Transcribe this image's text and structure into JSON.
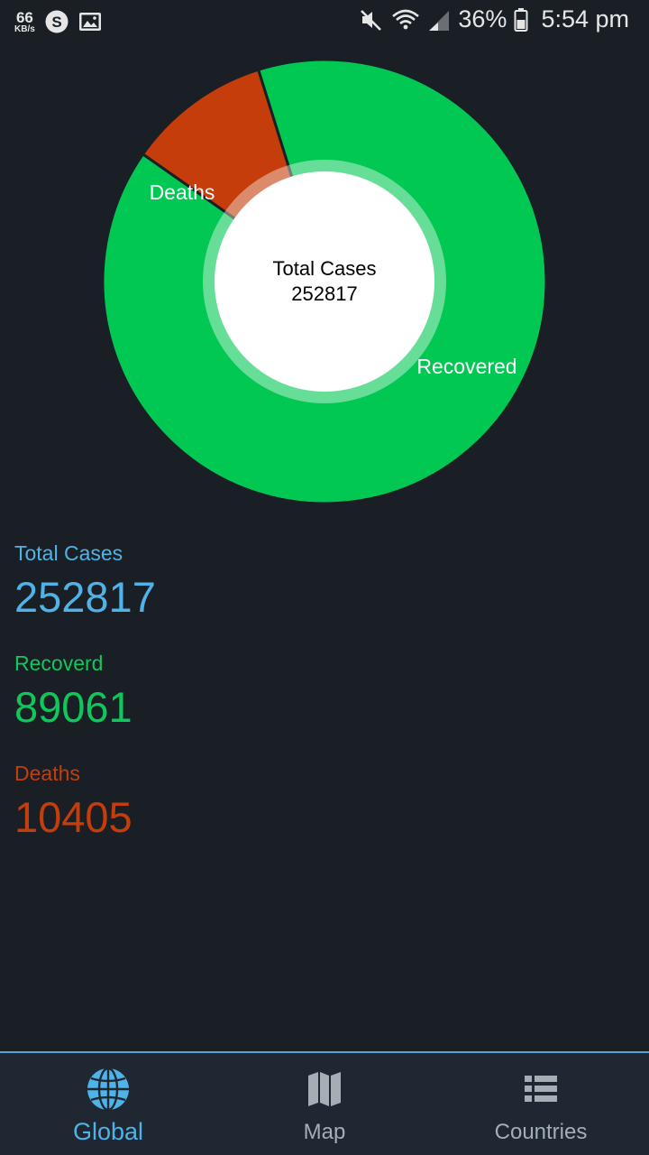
{
  "status_bar": {
    "net_speed": "66",
    "net_unit": "KB/s",
    "battery": "36%",
    "time": "5:54 pm"
  },
  "chart_data": {
    "type": "pie",
    "center_title": "Total Cases",
    "center_value": "252817",
    "slices": [
      {
        "label": "Deaths",
        "value": 10405,
        "color": "#c43d0b"
      },
      {
        "label": "Recovered",
        "value": 89061,
        "color": "#00c853"
      }
    ]
  },
  "stats": {
    "total_label": "Total Cases",
    "total_value": "252817",
    "recovered_label": "Recoverd",
    "recovered_value": "89061",
    "deaths_label": "Deaths",
    "deaths_value": "10405"
  },
  "nav": {
    "items": [
      {
        "label": "Global",
        "icon": "globe-icon",
        "active": true
      },
      {
        "label": "Map",
        "icon": "map-icon",
        "active": false
      },
      {
        "label": "Countries",
        "icon": "list-icon",
        "active": false
      }
    ]
  },
  "colors": {
    "background": "#1a1f26",
    "total": "#4fb3e8",
    "recovered": "#0fc75a",
    "deaths": "#c43d0b"
  }
}
